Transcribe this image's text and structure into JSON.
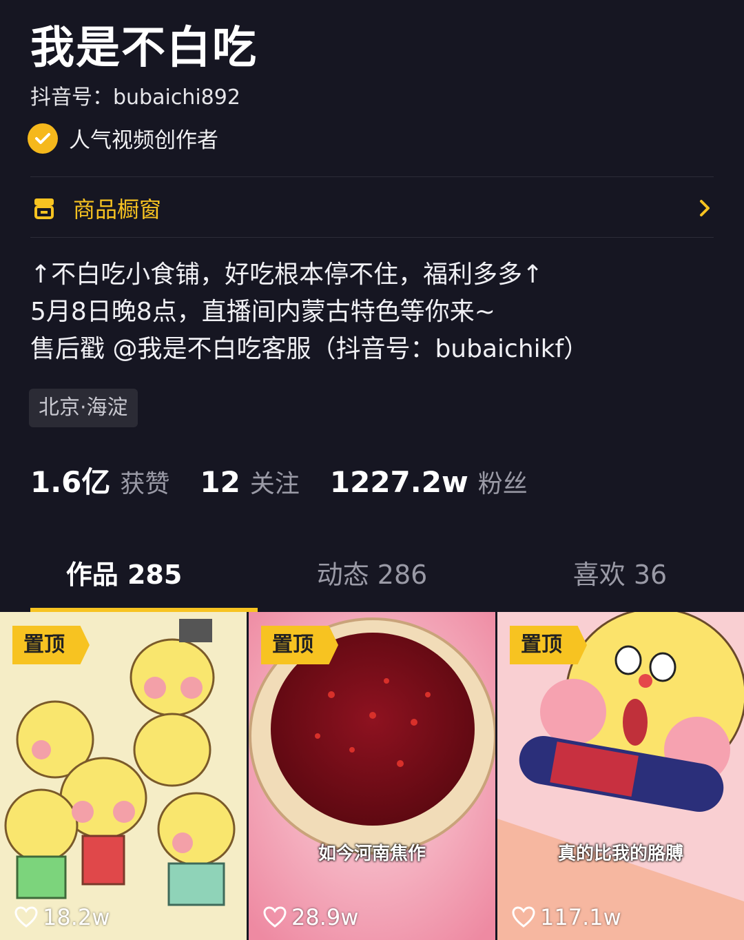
{
  "profile": {
    "nickname": "我是不白吃",
    "douyin_id": "抖音号：bubaichi892",
    "verification": "人气视频创作者",
    "shop_window": "商品橱窗",
    "bio": [
      "↑不白吃小食铺，好吃根本停不住，福利多多↑",
      "5月8日晚8点，直播间内蒙古特色等你来~",
      "售后戳 @我是不白吃客服（抖音号：bubaichikf）"
    ],
    "location": "北京·海淀"
  },
  "stats": [
    {
      "value": "1.6亿",
      "label": "获赞"
    },
    {
      "value": "12",
      "label": "关注"
    },
    {
      "value": "1227.2w",
      "label": "粉丝"
    }
  ],
  "tabs": [
    {
      "label": "作品 285",
      "active": true
    },
    {
      "label": "动态 286",
      "active": false
    },
    {
      "label": "喜欢 36",
      "active": false
    }
  ],
  "videos": [
    {
      "pinned": "置顶",
      "caption": "",
      "likes": "18.2w"
    },
    {
      "pinned": "置顶",
      "caption": "如今河南焦作",
      "likes": "28.9w"
    },
    {
      "pinned": "置顶",
      "caption": "真的比我的胳膊",
      "likes": "117.1w"
    }
  ],
  "colors": {
    "background": "#161622",
    "accent": "#f7c321",
    "muted": "#9a9aa6"
  },
  "icons": {
    "verify": "check-badge-icon",
    "shop": "store-icon",
    "chevron": "chevron-right-icon",
    "likes": "heart-outline-icon"
  }
}
